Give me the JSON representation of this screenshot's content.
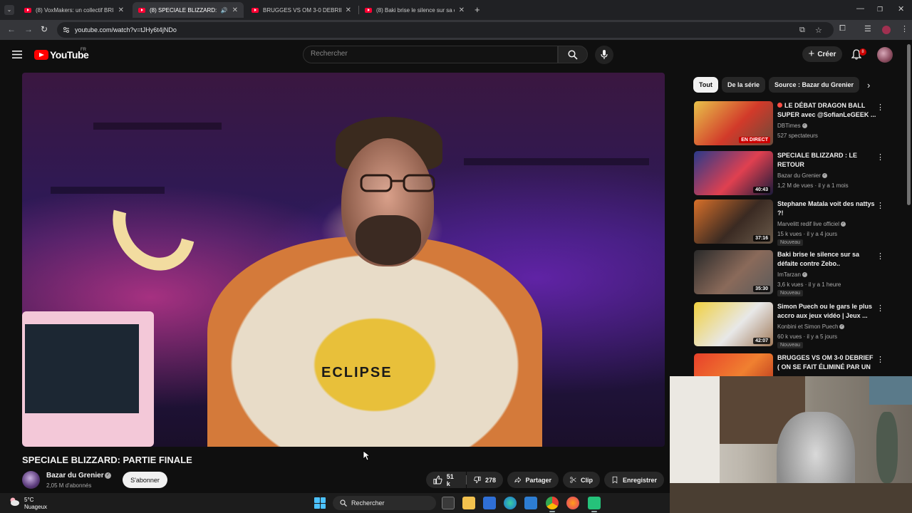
{
  "browser": {
    "tabs": [
      {
        "title": "(8) VoxMakers: un collectif BRIS...",
        "active": false
      },
      {
        "title": "(8) SPECIALE BLIZZARD: PA...",
        "active": true
      },
      {
        "title": "BRUGGES VS OM 3-0 DEBRIEF",
        "active": false
      },
      {
        "title": "(8) Baki brise le silence sur sa d...",
        "active": false
      }
    ],
    "url": "youtube.com/watch?v=tJHy6t4jNDo"
  },
  "youtube": {
    "logo_text": "YouTube",
    "logo_country": "FR",
    "search_placeholder": "Rechercher",
    "create_label": "Créer",
    "notifications_count": "8"
  },
  "video": {
    "title": "SPECIALE BLIZZARD: PARTIE FINALE",
    "shirt_text": "ECLIPSE",
    "channel_name": "Bazar du Grenier",
    "channel_subs": "2,05 M d'abonnés",
    "subscribe_label": "S'abonner",
    "likes": "51 k",
    "dislikes": "278",
    "share_label": "Partager",
    "clip_label": "Clip",
    "save_label": "Enregistrer"
  },
  "chips": [
    {
      "label": "Tout",
      "active": true
    },
    {
      "label": "De la série",
      "active": false
    },
    {
      "label": "Source : Bazar du Grenier",
      "active": false
    }
  ],
  "recommendations": [
    {
      "title": "LE DÉBAT DRAGON BALL SUPER avec @SofianLeGEEK ...",
      "channel": "DBTimes",
      "meta": "527 spectateurs",
      "duration": "EN DIRECT",
      "live": true,
      "badge": "",
      "thumb_colors": [
        "#e8c24a",
        "#d23a2a",
        "#6a4a3a"
      ]
    },
    {
      "title": "SPECIALE BLIZZARD : LE RETOUR",
      "channel": "Bazar du Grenier",
      "meta": "1,2 M de vues · il y a 1 mois",
      "duration": "40:43",
      "live": false,
      "badge": "",
      "thumb_colors": [
        "#2a3a8a",
        "#e04050",
        "#1a1a3a"
      ]
    },
    {
      "title": "Stephane Matala voit des nattys ?!",
      "channel": "Marvelitt redif live officiel",
      "meta": "15 k vues · il y a 4 jours",
      "duration": "37:16",
      "live": false,
      "badge": "Nouveau",
      "thumb_colors": [
        "#d8702a",
        "#3a2a22",
        "#6a5a4a"
      ]
    },
    {
      "title": "Baki brise le silence sur sa défaite contre Zebo..",
      "channel": "ImTarzan",
      "meta": "3,6 k vues · il y a 1 heure",
      "duration": "35:30",
      "live": false,
      "badge": "Nouveau",
      "thumb_colors": [
        "#2a2a2a",
        "#8a6a5a",
        "#5a5a5a"
      ]
    },
    {
      "title": "Simon Puech ou le gars le plus accro aux jeux vidéo | Jeux ...",
      "channel": "Konbini et Simon Puech",
      "meta": "60 k vues · il y a 5 jours",
      "duration": "42:07",
      "live": false,
      "badge": "Nouveau",
      "thumb_colors": [
        "#f0d040",
        "#e8e8e8",
        "#a07a5a"
      ]
    },
    {
      "title": "BRUGGES VS OM 3-0 DEBRIEF ( ON SE FAIT ÉLIMINÉ PAR UN ...",
      "channel": "",
      "meta": "",
      "duration": "",
      "live": false,
      "badge": "",
      "thumb_colors": [
        "#e8402a",
        "#f08030",
        "#b02a1a"
      ]
    }
  ],
  "taskbar": {
    "temperature": "5°C",
    "weather": "Nuageux",
    "search_label": "Rechercher"
  }
}
